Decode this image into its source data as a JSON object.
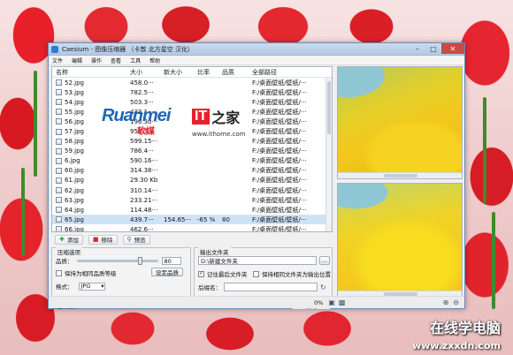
{
  "window": {
    "title": "Caesium - 图像压缩器 （卡敦 北方星空 汉化）"
  },
  "menu": [
    "文件",
    "编辑",
    "操作",
    "查看",
    "工具",
    "帮助"
  ],
  "list": {
    "headers": {
      "name": "名称",
      "size": "大小",
      "new_size": "新大小",
      "ratio": "比率",
      "quality": "品质",
      "path": "全部路径"
    },
    "rows": [
      {
        "name": "52.jpg",
        "size": "458.0···",
        "new_size": "",
        "ratio": "",
        "quality": "",
        "path": "F:/桌面壁纸/壁纸/···"
      },
      {
        "name": "53.jpg",
        "size": "782.5···",
        "new_size": "",
        "ratio": "",
        "quality": "",
        "path": "F:/桌面壁纸/壁纸/···"
      },
      {
        "name": "54.jpg",
        "size": "503.3···",
        "new_size": "",
        "ratio": "",
        "quality": "",
        "path": "F:/桌面壁纸/壁纸/···"
      },
      {
        "name": "55.jpg",
        "size": "432.1···",
        "new_size": "",
        "ratio": "",
        "quality": "",
        "path": "F:/桌面壁纸/壁纸/···"
      },
      {
        "name": "56.jpg",
        "size": "196.30···",
        "new_size": "",
        "ratio": "",
        "quality": "",
        "path": "F:/桌面壁纸/壁纸/···"
      },
      {
        "name": "57.jpg",
        "size": "950.3···",
        "new_size": "",
        "ratio": "",
        "quality": "",
        "path": "F:/桌面壁纸/壁纸/···"
      },
      {
        "name": "58.jpg",
        "size": "599.15···",
        "new_size": "",
        "ratio": "",
        "quality": "",
        "path": "F:/桌面壁纸/壁纸/···"
      },
      {
        "name": "59.jpg",
        "size": "786.4···",
        "new_size": "",
        "ratio": "",
        "quality": "",
        "path": "F:/桌面壁纸/壁纸/···"
      },
      {
        "name": "6.jpg",
        "size": "590.16···",
        "new_size": "",
        "ratio": "",
        "quality": "",
        "path": "F:/桌面壁纸/壁纸/···"
      },
      {
        "name": "60.jpg",
        "size": "314.38···",
        "new_size": "",
        "ratio": "",
        "quality": "",
        "path": "F:/桌面壁纸/壁纸/···"
      },
      {
        "name": "61.jpg",
        "size": "29.30 Kb",
        "new_size": "",
        "ratio": "",
        "quality": "",
        "path": "F:/桌面壁纸/壁纸/···"
      },
      {
        "name": "62.jpg",
        "size": "310.14···",
        "new_size": "",
        "ratio": "",
        "quality": "",
        "path": "F:/桌面壁纸/壁纸/···"
      },
      {
        "name": "63.jpg",
        "size": "233.21···",
        "new_size": "",
        "ratio": "",
        "quality": "",
        "path": "F:/桌面壁纸/壁纸/···"
      },
      {
        "name": "64.jpg",
        "size": "114.48···",
        "new_size": "",
        "ratio": "",
        "quality": "",
        "path": "F:/桌面壁纸/壁纸/···"
      },
      {
        "name": "65.jpg",
        "size": "439.7···",
        "new_size": "154.65···",
        "ratio": "-65 %",
        "quality": "80",
        "path": "F:/桌面壁纸/壁纸/···"
      },
      {
        "name": "66.jpg",
        "size": "462.6···",
        "new_size": "",
        "ratio": "",
        "quality": "",
        "path": "F:/桌面壁纸/壁纸/···"
      }
    ],
    "selected_index": 14
  },
  "watermarks": {
    "ruanmei_main": "Ruanmei",
    "ruanmei_sub": "软媒",
    "ithome_it": "IT",
    "ithome_cn": "之家",
    "ithome_url": "www.ithome.com",
    "site_cn": "在线学电脑",
    "site_url": "www.zxxdn.com"
  },
  "toolbar": {
    "add_label": "添加",
    "remove_label": "移除",
    "preview_label": "预览"
  },
  "compress": {
    "title": "压缩选项",
    "quality_label": "品质：",
    "quality_value": "80",
    "quality_fraction": 0.8,
    "keep_quality_label": "保持为相同品质等级",
    "set_quality_button": "设定品质",
    "format_label": "格式：",
    "format_value": "JPG"
  },
  "output": {
    "title": "输出文件夹",
    "folder_value": "D:\\新建文件夹",
    "browse_label": "...",
    "remember_label": "记住最后文件夹",
    "remember_checked": true,
    "same_folder_label": "保持相同文件夹为输出位置",
    "same_folder_checked": false,
    "suffix_label": "后缀名：",
    "suffix_value": ""
  },
  "status": {
    "count_label": "项目计数：",
    "count_value": "129",
    "compress_button": "压缩",
    "progress_text": "0%"
  },
  "colors": {
    "accent": "#2e7bd0",
    "selection": "#cfe3f8",
    "close_button": "#c94a44"
  }
}
